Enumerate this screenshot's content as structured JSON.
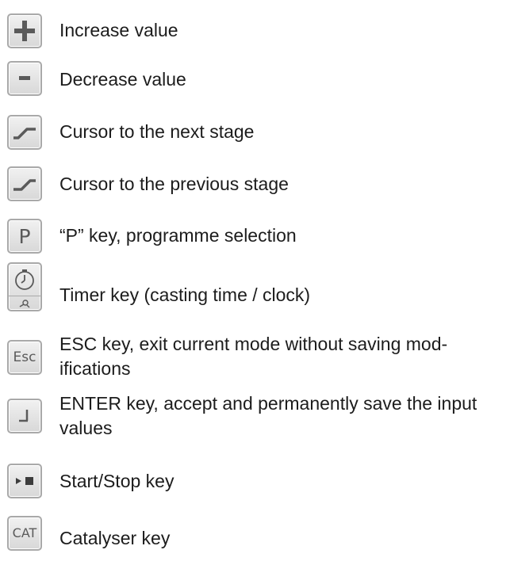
{
  "keys": [
    {
      "icon": "plus-icon",
      "description": "Increase value"
    },
    {
      "icon": "minus-icon",
      "description": "Decrease value"
    },
    {
      "icon": "ramp-next-icon",
      "description": "Cursor to the next stage"
    },
    {
      "icon": "ramp-previous-icon",
      "description": "Cursor to the previous stage"
    },
    {
      "icon": "p-key-icon",
      "key_text": "P",
      "description": "“P” key, programme selection"
    },
    {
      "icon": "timer-icon",
      "description": "Timer key (casting  time / clock)"
    },
    {
      "icon": "esc-key-icon",
      "key_text": "Esc",
      "description": "ESC key, exit current mode without saving mod-ifications"
    },
    {
      "icon": "enter-icon",
      "description": "ENTER key, accept and permanently save the input values"
    },
    {
      "icon": "start-stop-icon",
      "description": "Start/Stop key"
    },
    {
      "icon": "cat-key-icon",
      "key_text": "CAT",
      "description": "Catalyser key"
    }
  ],
  "colors": {
    "key_border": "#a9a9a9",
    "key_face": "#e6e6e6",
    "key_symbol": "#5a5a5a",
    "text": "#1c1c1c"
  }
}
